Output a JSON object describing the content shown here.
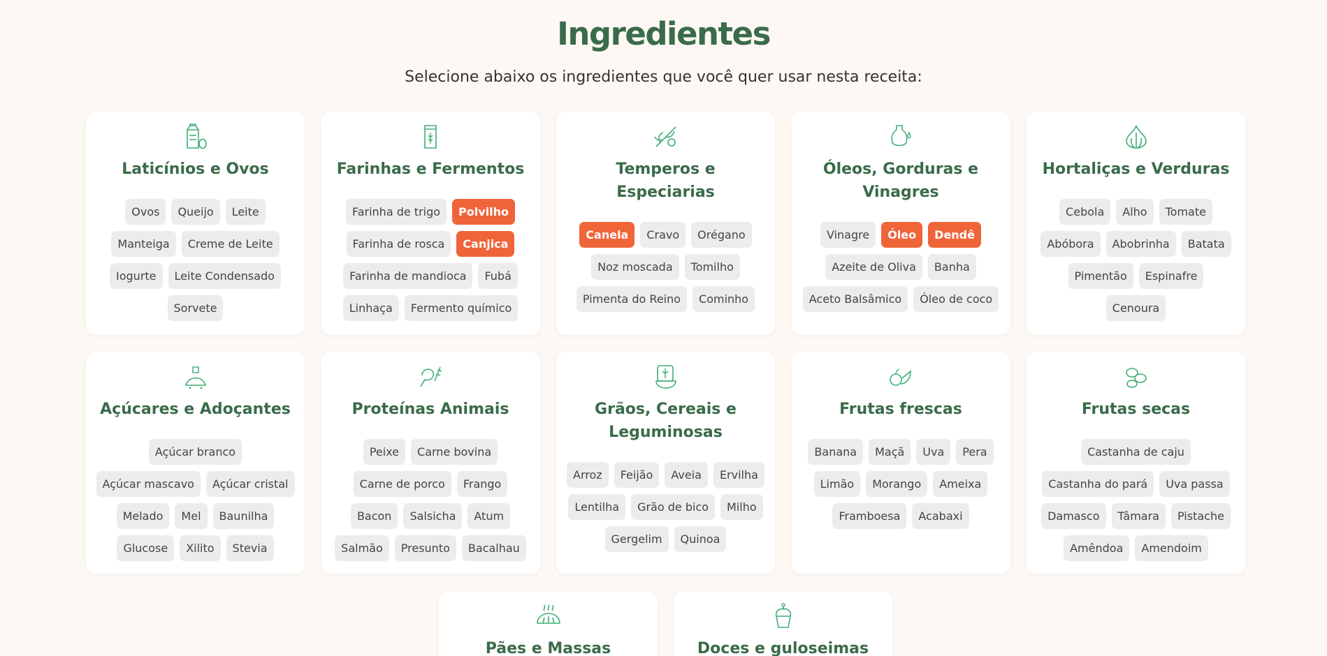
{
  "page": {
    "title": "Ingredientes",
    "subtitle": "Selecione abaixo os ingredientes que você quer usar nesta receita:"
  },
  "colors": {
    "accent": "#f0643a",
    "brand": "#3a6b4a",
    "chip": "#ececec",
    "background": "#fdf8f3"
  },
  "categories": [
    {
      "title": "Laticínios e Ovos",
      "icon": "milk-carton-icon",
      "items": [
        {
          "label": "Ovos",
          "selected": false
        },
        {
          "label": "Queijo",
          "selected": false
        },
        {
          "label": "Leite",
          "selected": false
        },
        {
          "label": "Manteiga",
          "selected": false
        },
        {
          "label": "Creme de Leite",
          "selected": false
        },
        {
          "label": "Iogurte",
          "selected": false
        },
        {
          "label": "Leite Condensado",
          "selected": false
        },
        {
          "label": "Sorvete",
          "selected": false
        }
      ]
    },
    {
      "title": "Farinhas e Fermentos",
      "icon": "flour-bag-icon",
      "items": [
        {
          "label": "Farinha de trigo",
          "selected": false
        },
        {
          "label": "Polvilho",
          "selected": true
        },
        {
          "label": "Farinha de rosca",
          "selected": false
        },
        {
          "label": "Canjica",
          "selected": true
        },
        {
          "label": "Farinha de mandioca",
          "selected": false
        },
        {
          "label": "Fubá",
          "selected": false
        },
        {
          "label": "Linhaça",
          "selected": false
        },
        {
          "label": "Fermento químico",
          "selected": false
        }
      ]
    },
    {
      "title": "Temperos e Especiarias",
      "icon": "herbs-icon",
      "items": [
        {
          "label": "Canela",
          "selected": true
        },
        {
          "label": "Cravo",
          "selected": false
        },
        {
          "label": "Orégano",
          "selected": false
        },
        {
          "label": "Noz moscada",
          "selected": false
        },
        {
          "label": "Tomilho",
          "selected": false
        },
        {
          "label": "Pimenta do Reino",
          "selected": false
        },
        {
          "label": "Cominho",
          "selected": false
        }
      ]
    },
    {
      "title": "Óleos, Gorduras e Vinagres",
      "icon": "oil-bottle-icon",
      "items": [
        {
          "label": "Vinagre",
          "selected": false
        },
        {
          "label": "Óleo",
          "selected": true
        },
        {
          "label": "Dendê",
          "selected": true
        },
        {
          "label": "Azeite de Oliva",
          "selected": false
        },
        {
          "label": "Banha",
          "selected": false
        },
        {
          "label": "Aceto Balsâmico",
          "selected": false
        },
        {
          "label": "Óleo de coco",
          "selected": false
        }
      ]
    },
    {
      "title": "Hortaliças e Verduras",
      "icon": "garlic-icon",
      "items": [
        {
          "label": "Cebola",
          "selected": false
        },
        {
          "label": "Alho",
          "selected": false
        },
        {
          "label": "Tomate",
          "selected": false
        },
        {
          "label": "Abóbora",
          "selected": false
        },
        {
          "label": "Abobrinha",
          "selected": false
        },
        {
          "label": "Batata",
          "selected": false
        },
        {
          "label": "Pimentão",
          "selected": false
        },
        {
          "label": "Espinafre",
          "selected": false
        },
        {
          "label": "Cenoura",
          "selected": false
        }
      ]
    },
    {
      "title": "Açúcares e Adoçantes",
      "icon": "sugar-pile-icon",
      "items": [
        {
          "label": "Açúcar branco",
          "selected": false
        },
        {
          "label": "Açúcar mascavo",
          "selected": false
        },
        {
          "label": "Açúcar cristal",
          "selected": false
        },
        {
          "label": "Melado",
          "selected": false
        },
        {
          "label": "Mel",
          "selected": false
        },
        {
          "label": "Baunilha",
          "selected": false
        },
        {
          "label": "Glucose",
          "selected": false
        },
        {
          "label": "Xilito",
          "selected": false
        },
        {
          "label": "Stevia",
          "selected": false
        }
      ]
    },
    {
      "title": "Proteínas Animais",
      "icon": "meat-icon",
      "items": [
        {
          "label": "Peixe",
          "selected": false
        },
        {
          "label": "Carne bovina",
          "selected": false
        },
        {
          "label": "Carne de porco",
          "selected": false
        },
        {
          "label": "Frango",
          "selected": false
        },
        {
          "label": "Bacon",
          "selected": false
        },
        {
          "label": "Salsicha",
          "selected": false
        },
        {
          "label": "Atum",
          "selected": false
        },
        {
          "label": "Salmão",
          "selected": false
        },
        {
          "label": "Presunto",
          "selected": false
        },
        {
          "label": "Bacalhau",
          "selected": false
        }
      ]
    },
    {
      "title": "Grãos, Cereais e Leguminosas",
      "icon": "grain-bowl-icon",
      "items": [
        {
          "label": "Arroz",
          "selected": false
        },
        {
          "label": "Feijão",
          "selected": false
        },
        {
          "label": "Aveia",
          "selected": false
        },
        {
          "label": "Ervilha",
          "selected": false
        },
        {
          "label": "Lentilha",
          "selected": false
        },
        {
          "label": "Grão de bico",
          "selected": false
        },
        {
          "label": "Milho",
          "selected": false
        },
        {
          "label": "Gergelim",
          "selected": false
        },
        {
          "label": "Quinoa",
          "selected": false
        }
      ]
    },
    {
      "title": "Frutas frescas",
      "icon": "fruits-icon",
      "items": [
        {
          "label": "Banana",
          "selected": false
        },
        {
          "label": "Maçã",
          "selected": false
        },
        {
          "label": "Uva",
          "selected": false
        },
        {
          "label": "Pera",
          "selected": false
        },
        {
          "label": "Limão",
          "selected": false
        },
        {
          "label": "Morango",
          "selected": false
        },
        {
          "label": "Ameixa",
          "selected": false
        },
        {
          "label": "Framboesa",
          "selected": false
        },
        {
          "label": "Acabaxi",
          "selected": false
        }
      ]
    },
    {
      "title": "Frutas secas",
      "icon": "dried-fruits-icon",
      "items": [
        {
          "label": "Castanha de caju",
          "selected": false
        },
        {
          "label": "Castanha do pará",
          "selected": false
        },
        {
          "label": "Uva passa",
          "selected": false
        },
        {
          "label": "Damasco",
          "selected": false
        },
        {
          "label": "Tâmara",
          "selected": false
        },
        {
          "label": "Pistache",
          "selected": false
        },
        {
          "label": "Amêndoa",
          "selected": false
        },
        {
          "label": "Amendoim",
          "selected": false
        }
      ]
    },
    {
      "title": "Pães e Massas",
      "icon": "bread-icon",
      "items": []
    },
    {
      "title": "Doces e guloseimas",
      "icon": "cupcake-icon",
      "items": []
    }
  ]
}
